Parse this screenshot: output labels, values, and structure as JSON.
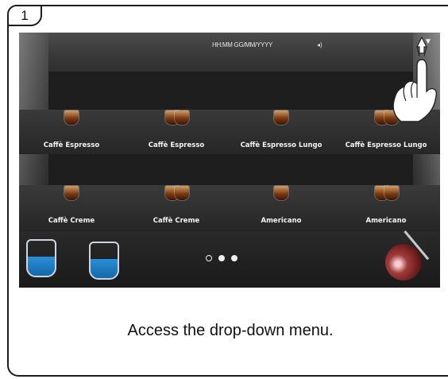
{
  "step": {
    "number": "1"
  },
  "screen": {
    "datetime": "HH:MM GG/MM/YYYY",
    "speaker_icon": "speaker-icon",
    "dropdown_icon": "chevron-down-icon",
    "page_dots": [
      "inactive",
      "active",
      "active"
    ]
  },
  "drinks_row1": [
    {
      "label": "Caffè Espresso",
      "cups": 1
    },
    {
      "label": "Caffè Espresso",
      "cups": 2
    },
    {
      "label": "Caffè Espresso Lungo",
      "cups": 1
    },
    {
      "label": "Caffè Espresso Lungo",
      "cups": 2
    }
  ],
  "drinks_row2": [
    {
      "label": "Caffè Creme",
      "cups": 1
    },
    {
      "label": "Caffè Creme",
      "cups": 2
    },
    {
      "label": "Americano",
      "cups": 1
    },
    {
      "label": "Americano",
      "cups": 2
    }
  ],
  "bottom_icons": [
    "milk-jug-icon",
    "water-jug-icon",
    "steam-wand-icon"
  ],
  "caption": "Access the drop-down menu."
}
